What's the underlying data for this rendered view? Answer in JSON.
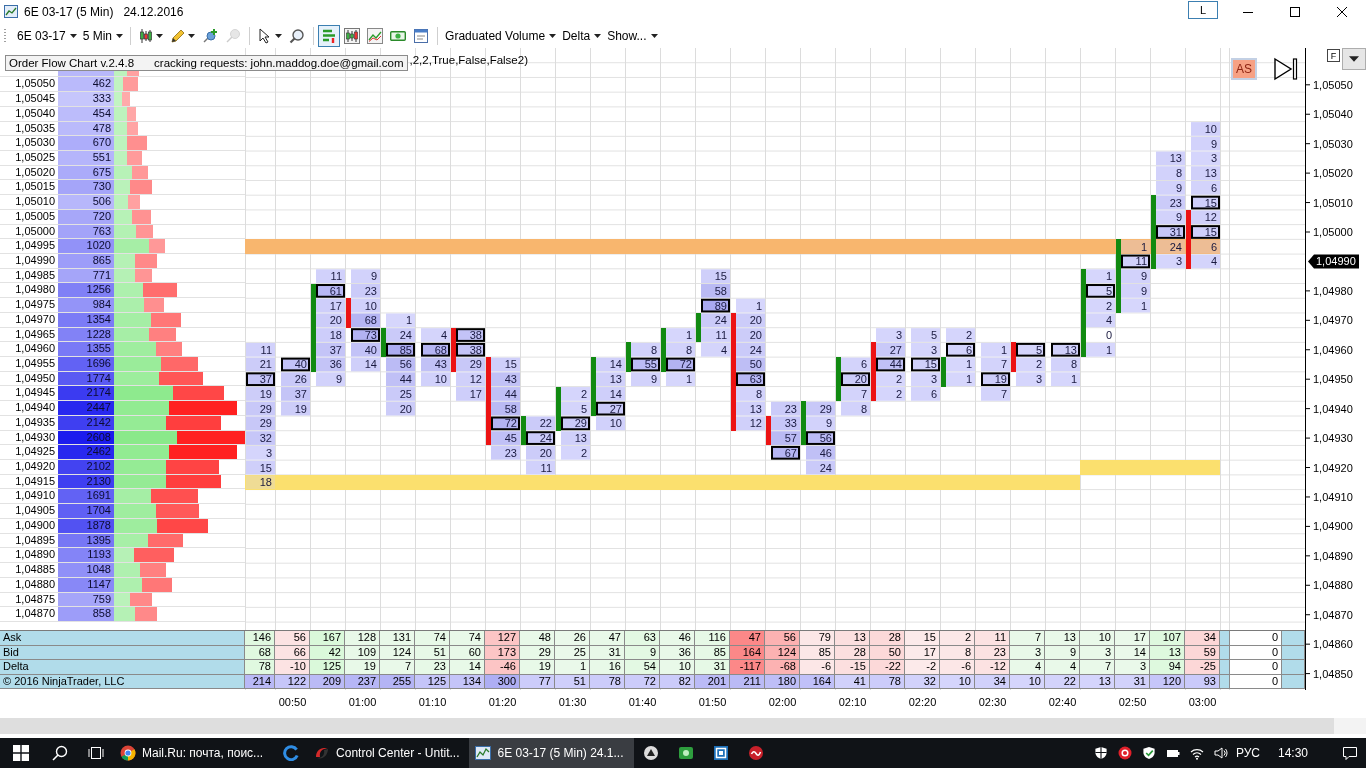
{
  "window": {
    "title": "6E 03-17 (5 Min)",
    "date": "24.12.2016",
    "layout_button": "L"
  },
  "toolbar": {
    "selectors": [
      {
        "label": "6E 03-17"
      },
      {
        "label": "5 Min"
      }
    ],
    "tool_groups": [
      [
        {
          "kind": "menu",
          "selected": false,
          "disabled": false
        },
        {
          "kind": "menu",
          "selected": false,
          "disabled": false
        },
        {
          "kind": "button",
          "selected": false,
          "disabled": false
        },
        {
          "kind": "button",
          "selected": false,
          "disabled": true
        }
      ],
      [
        {
          "kind": "menu",
          "selected": false,
          "disabled": false
        },
        {
          "kind": "button",
          "selected": false,
          "disabled": false
        }
      ],
      [
        {
          "kind": "button",
          "selected": true,
          "disabled": false
        },
        {
          "kind": "button",
          "selected": false,
          "disabled": false
        },
        {
          "kind": "button",
          "selected": false,
          "disabled": false
        },
        {
          "kind": "button",
          "selected": false,
          "disabled": false
        },
        {
          "kind": "button",
          "selected": false,
          "disabled": false
        }
      ]
    ],
    "menus": [
      {
        "label": "Graduated Volume"
      },
      {
        "label": "Delta"
      },
      {
        "label": "Show..."
      }
    ]
  },
  "info_label": {
    "title": "Order Flow Chart v.2.4.8",
    "note": "cracking requests: john.maddog.doe@gmail.com"
  },
  "indicator_params": ",2,2,True,False,False2)",
  "ladder": [
    {
      "buy": {
        "level": 0.1
      },
      "total": {
        "level": 0.19
      }
    },
    {
      "price": "1,05050",
      "volume": "462",
      "buy": {
        "level": 0.07
      },
      "total": {
        "level": 0.18
      }
    },
    {
      "price": "1,05045",
      "volume": "333",
      "buy": {
        "level": 0.06
      },
      "total": {
        "level": 0.12
      }
    },
    {
      "price": "1,05040",
      "volume": "454",
      "buy": {
        "level": 0.1
      },
      "total": {
        "level": 0.17
      }
    },
    {
      "price": "1,05035",
      "volume": "478",
      "buy": {
        "level": 0.1
      },
      "total": {
        "level": 0.18
      },
      "cells": [
        null,
        null,
        null,
        null,
        null,
        null,
        null,
        null,
        null,
        null,
        null,
        null,
        null,
        null,
        null,
        null,
        null,
        null,
        null,
        null,
        null,
        null,
        null,
        null,
        null,
        null,
        null,
        {
          "value": "10",
          "boxed": false
        }
      ]
    },
    {
      "price": "1,05030",
      "volume": "670",
      "buy": {
        "level": 0.1
      },
      "total": {
        "level": 0.25
      },
      "cells": [
        null,
        null,
        null,
        null,
        null,
        null,
        null,
        null,
        null,
        null,
        null,
        null,
        null,
        null,
        null,
        null,
        null,
        null,
        null,
        null,
        null,
        null,
        null,
        null,
        null,
        null,
        null,
        {
          "value": "9",
          "boxed": false
        }
      ]
    },
    {
      "price": "1,05025",
      "volume": "551",
      "buy": {
        "level": 0.1
      },
      "total": {
        "level": 0.21
      },
      "cells": [
        null,
        null,
        null,
        null,
        null,
        null,
        null,
        null,
        null,
        null,
        null,
        null,
        null,
        null,
        null,
        null,
        null,
        null,
        null,
        null,
        null,
        null,
        null,
        null,
        null,
        null,
        {
          "value": "13",
          "boxed": false
        },
        {
          "value": "3",
          "boxed": false
        }
      ]
    },
    {
      "price": "1,05020",
      "volume": "675",
      "buy": {
        "level": 0.14
      },
      "total": {
        "level": 0.26
      },
      "cells": [
        null,
        null,
        null,
        null,
        null,
        null,
        null,
        null,
        null,
        null,
        null,
        null,
        null,
        null,
        null,
        null,
        null,
        null,
        null,
        null,
        null,
        null,
        null,
        null,
        null,
        null,
        {
          "value": "8",
          "boxed": false
        },
        {
          "value": "13",
          "boxed": false
        }
      ]
    },
    {
      "price": "1,05015",
      "volume": "730",
      "buy": {
        "level": 0.12
      },
      "total": {
        "level": 0.29
      },
      "cells": [
        null,
        null,
        null,
        null,
        null,
        null,
        null,
        null,
        null,
        null,
        null,
        null,
        null,
        null,
        null,
        null,
        null,
        null,
        null,
        null,
        null,
        null,
        null,
        null,
        null,
        null,
        {
          "value": "9",
          "boxed": false
        },
        {
          "value": "6",
          "boxed": false
        }
      ]
    },
    {
      "price": "1,05010",
      "volume": "506",
      "buy": {
        "level": 0.11
      },
      "total": {
        "level": 0.2
      },
      "cells": [
        null,
        null,
        null,
        null,
        null,
        null,
        null,
        null,
        null,
        null,
        null,
        null,
        null,
        null,
        null,
        null,
        null,
        null,
        null,
        null,
        null,
        null,
        null,
        null,
        null,
        null,
        {
          "value": "23",
          "boxed": false,
          "bar": {
            "color": "#118a11"
          }
        },
        {
          "value": "15",
          "boxed": true
        }
      ]
    },
    {
      "price": "1,05005",
      "volume": "720",
      "buy": {
        "level": 0.14
      },
      "total": {
        "level": 0.28
      },
      "cells": [
        null,
        null,
        null,
        null,
        null,
        null,
        null,
        null,
        null,
        null,
        null,
        null,
        null,
        null,
        null,
        null,
        null,
        null,
        null,
        null,
        null,
        null,
        null,
        null,
        null,
        null,
        {
          "value": "9",
          "boxed": false,
          "bar": {
            "color": "#118a11"
          }
        },
        {
          "value": "12",
          "boxed": false,
          "bar": {
            "color": "#ec1313"
          }
        }
      ]
    },
    {
      "price": "1,05000",
      "volume": "763",
      "buy": {
        "level": 0.17
      },
      "total": {
        "level": 0.3
      },
      "cells": [
        null,
        null,
        null,
        null,
        null,
        null,
        null,
        null,
        null,
        null,
        null,
        null,
        null,
        null,
        null,
        null,
        null,
        null,
        null,
        null,
        null,
        null,
        null,
        null,
        null,
        null,
        {
          "value": "31",
          "boxed": true,
          "bar": {
            "color": "#118a11"
          }
        },
        {
          "value": "15",
          "boxed": true,
          "bar": {
            "color": "#ec1313"
          }
        }
      ]
    },
    {
      "price": "1,04995",
      "volume": "1020",
      "buy": {
        "level": 0.27
      },
      "total": {
        "level": 0.39
      },
      "cells": [
        {
          "band": {
            "color": "#f8b66e"
          }
        },
        {
          "band": {
            "color": "#f8b66e"
          }
        },
        {
          "band": {
            "color": "#f8b66e"
          }
        },
        {
          "band": {
            "color": "#f8b66e"
          }
        },
        {
          "band": {
            "color": "#f8b66e"
          }
        },
        {
          "band": {
            "color": "#f8b66e"
          }
        },
        {
          "band": {
            "color": "#f8b66e"
          }
        },
        {
          "band": {
            "color": "#f8b66e"
          }
        },
        {
          "band": {
            "color": "#f8b66e"
          }
        },
        {
          "band": {
            "color": "#f8b66e"
          }
        },
        {
          "band": {
            "color": "#f8b66e"
          }
        },
        {
          "band": {
            "color": "#f8b66e"
          }
        },
        {
          "band": {
            "color": "#f8b66e"
          }
        },
        {
          "band": {
            "color": "#f8b66e"
          }
        },
        {
          "band": {
            "color": "#f8b66e"
          }
        },
        {
          "band": {
            "color": "#f8b66e"
          }
        },
        {
          "band": {
            "color": "#f8b66e"
          }
        },
        {
          "band": {
            "color": "#f8b66e"
          }
        },
        {
          "band": {
            "color": "#f8b66e"
          }
        },
        {
          "band": {
            "color": "#f8b66e"
          }
        },
        {
          "band": {
            "color": "#f8b66e"
          }
        },
        {
          "band": {
            "color": "#f8b66e"
          }
        },
        {
          "band": {
            "color": "#f8b66e"
          }
        },
        {
          "band": {
            "color": "#f8b66e"
          }
        },
        {
          "band": {
            "color": "#f8b66e"
          }
        },
        {
          "value": "1",
          "boxed": false,
          "bar": {
            "color": "#118a11"
          },
          "band": {
            "color": "#f8b66e"
          }
        },
        {
          "value": "24",
          "boxed": false,
          "bar": {
            "color": "#118a11"
          },
          "band": {
            "color": "#f8b66e"
          }
        },
        {
          "value": "6",
          "boxed": false,
          "bar": {
            "color": "#ec1313"
          },
          "band": {
            "color": "#f8b66e"
          }
        }
      ]
    },
    {
      "price": "1,04990",
      "volume": "865",
      "buy": {
        "level": 0.16
      },
      "total": {
        "level": 0.33
      },
      "cells": [
        null,
        null,
        null,
        null,
        null,
        null,
        null,
        null,
        null,
        null,
        null,
        null,
        null,
        null,
        null,
        null,
        null,
        null,
        null,
        null,
        null,
        null,
        null,
        null,
        null,
        {
          "value": "11",
          "boxed": true,
          "bar": {
            "color": "#118a11"
          }
        },
        {
          "value": "3",
          "boxed": false,
          "bar": {
            "color": "#118a11"
          }
        },
        {
          "value": "4",
          "boxed": false,
          "bar": {
            "color": "#ec1313"
          }
        }
      ]
    },
    {
      "price": "1,04985",
      "volume": "771",
      "buy": {
        "level": 0.16
      },
      "total": {
        "level": 0.29
      },
      "cells": [
        null,
        null,
        {
          "value": "11",
          "boxed": false
        },
        {
          "value": "9",
          "boxed": false
        },
        null,
        null,
        null,
        null,
        null,
        null,
        null,
        null,
        null,
        {
          "value": "15",
          "boxed": false
        },
        null,
        null,
        null,
        null,
        null,
        null,
        null,
        null,
        null,
        null,
        {
          "value": "1",
          "boxed": false,
          "bar": {
            "color": "#118a11"
          }
        },
        {
          "value": "9",
          "boxed": false,
          "bar": {
            "color": "#118a11"
          }
        }
      ]
    },
    {
      "price": "1,04980",
      "volume": "1256",
      "buy": {
        "level": 0.22
      },
      "total": {
        "level": 0.48
      },
      "cells": [
        null,
        null,
        {
          "value": "61",
          "boxed": true,
          "bar": {
            "color": "#118a11"
          }
        },
        {
          "value": "23",
          "boxed": false
        },
        null,
        null,
        null,
        null,
        null,
        null,
        null,
        null,
        null,
        {
          "value": "58",
          "boxed": false
        },
        null,
        null,
        null,
        null,
        null,
        null,
        null,
        null,
        null,
        null,
        {
          "value": "5",
          "boxed": true,
          "bar": {
            "color": "#118a11"
          }
        },
        {
          "value": "9",
          "boxed": false,
          "bar": {
            "color": "#118a11"
          }
        }
      ]
    },
    {
      "price": "1,04975",
      "volume": "984",
      "buy": {
        "level": 0.23
      },
      "total": {
        "level": 0.38
      },
      "cells": [
        null,
        null,
        {
          "value": "17",
          "boxed": false,
          "bar": {
            "color": "#118a11"
          }
        },
        {
          "value": "10",
          "boxed": false,
          "bar": {
            "color": "#ec1313"
          }
        },
        null,
        null,
        null,
        null,
        null,
        null,
        null,
        null,
        null,
        {
          "value": "89",
          "boxed": true
        },
        {
          "value": "1",
          "boxed": false
        },
        null,
        null,
        null,
        null,
        null,
        null,
        null,
        null,
        null,
        {
          "value": "2",
          "boxed": false,
          "bar": {
            "color": "#118a11"
          }
        },
        {
          "value": "1",
          "boxed": false,
          "bar": {
            "color": "#118a11"
          }
        }
      ]
    },
    {
      "price": "1,04970",
      "volume": "1354",
      "buy": {
        "level": 0.28
      },
      "total": {
        "level": 0.51
      },
      "cells": [
        null,
        null,
        {
          "value": "20",
          "boxed": false,
          "bar": {
            "color": "#118a11"
          }
        },
        {
          "value": "68",
          "boxed": false,
          "bar": {
            "color": "#ec1313"
          }
        },
        {
          "value": "1",
          "boxed": false
        },
        null,
        null,
        null,
        null,
        null,
        null,
        null,
        null,
        {
          "value": "24",
          "boxed": false,
          "bar": {
            "color": "#118a11"
          }
        },
        {
          "value": "20",
          "boxed": false,
          "bar": {
            "color": "#ec1313"
          }
        },
        null,
        null,
        null,
        null,
        null,
        null,
        null,
        null,
        null,
        {
          "value": "4",
          "boxed": false,
          "bar": {
            "color": "#118a11"
          }
        }
      ]
    },
    {
      "price": "1,04965",
      "volume": "1228",
      "buy": {
        "level": 0.27
      },
      "total": {
        "level": 0.47
      },
      "cells": [
        null,
        null,
        {
          "value": "18",
          "boxed": false,
          "bar": {
            "color": "#118a11"
          }
        },
        {
          "value": "73",
          "boxed": true
        },
        {
          "value": "24",
          "boxed": false,
          "bar": {
            "color": "#118a11"
          }
        },
        {
          "value": "4",
          "boxed": false
        },
        {
          "value": "38",
          "boxed": true,
          "bar": {
            "color": "#ec1313"
          }
        },
        null,
        null,
        null,
        null,
        null,
        {
          "value": "1",
          "boxed": false,
          "bar": {
            "color": "#118a11"
          }
        },
        {
          "value": "11",
          "boxed": false,
          "bar": {
            "color": "#118a11"
          }
        },
        {
          "value": "20",
          "boxed": false,
          "bar": {
            "color": "#ec1313"
          }
        },
        null,
        null,
        null,
        {
          "value": "3",
          "boxed": false
        },
        {
          "value": "5",
          "boxed": false
        },
        {
          "value": "2",
          "boxed": false
        },
        null,
        null,
        null,
        {
          "value": "0",
          "boxed": false,
          "bar": {
            "color": "#118a11"
          }
        }
      ]
    },
    {
      "price": "1,04960",
      "volume": "1355",
      "buy": {
        "level": 0.32
      },
      "total": {
        "level": 0.52
      },
      "cells": [
        {
          "value": "11",
          "boxed": false
        },
        null,
        {
          "value": "37",
          "boxed": false,
          "bar": {
            "color": "#118a11"
          }
        },
        {
          "value": "40",
          "boxed": false
        },
        {
          "value": "85",
          "boxed": true,
          "bar": {
            "color": "#118a11"
          }
        },
        {
          "value": "68",
          "boxed": true
        },
        {
          "value": "38",
          "boxed": true,
          "bar": {
            "color": "#ec1313"
          }
        },
        null,
        null,
        null,
        null,
        {
          "value": "8",
          "boxed": false,
          "bar": {
            "color": "#118a11"
          }
        },
        {
          "value": "8",
          "boxed": false,
          "bar": {
            "color": "#118a11"
          }
        },
        {
          "value": "4",
          "boxed": false
        },
        {
          "value": "24",
          "boxed": false,
          "bar": {
            "color": "#ec1313"
          }
        },
        null,
        null,
        null,
        {
          "value": "27",
          "boxed": false,
          "bar": {
            "color": "#ec1313"
          }
        },
        {
          "value": "3",
          "boxed": false
        },
        {
          "value": "6",
          "boxed": true
        },
        {
          "value": "1",
          "boxed": false
        },
        {
          "value": "5",
          "boxed": true,
          "bar": {
            "color": "#ec1313"
          }
        },
        {
          "value": "13",
          "boxed": true
        },
        {
          "value": "1",
          "boxed": false,
          "bar": {
            "color": "#118a11"
          }
        }
      ]
    },
    {
      "price": "1,04955",
      "volume": "1696",
      "buy": {
        "level": 0.36
      },
      "total": {
        "level": 0.64
      },
      "cells": [
        {
          "value": "21",
          "boxed": false
        },
        {
          "value": "40",
          "boxed": true
        },
        {
          "value": "36",
          "boxed": false,
          "bar": {
            "color": "#118a11"
          }
        },
        {
          "value": "14",
          "boxed": false
        },
        {
          "value": "56",
          "boxed": false
        },
        {
          "value": "43",
          "boxed": false
        },
        {
          "value": "29",
          "boxed": false,
          "bar": {
            "color": "#ec1313"
          }
        },
        {
          "value": "15",
          "boxed": false,
          "bar": {
            "color": "#ec1313"
          }
        },
        null,
        null,
        {
          "value": "14",
          "boxed": false,
          "bar": {
            "color": "#118a11"
          }
        },
        {
          "value": "55",
          "boxed": true,
          "bar": {
            "color": "#118a11"
          }
        },
        {
          "value": "72",
          "boxed": true,
          "bar": {
            "color": "#118a11"
          }
        },
        null,
        {
          "value": "50",
          "boxed": false,
          "bar": {
            "color": "#ec1313"
          }
        },
        null,
        null,
        {
          "value": "6",
          "boxed": false,
          "bar": {
            "color": "#118a11"
          }
        },
        {
          "value": "44",
          "boxed": true,
          "bar": {
            "color": "#ec1313"
          }
        },
        {
          "value": "15",
          "boxed": true
        },
        {
          "value": "1",
          "boxed": false,
          "bar": {
            "color": "#118a11"
          }
        },
        {
          "value": "7",
          "boxed": false
        },
        {
          "value": "2",
          "boxed": false,
          "bar": {
            "color": "#ec1313"
          }
        },
        {
          "value": "8",
          "boxed": false
        }
      ]
    },
    {
      "price": "1,04950",
      "volume": "1774",
      "buy": {
        "level": 0.34
      },
      "total": {
        "level": 0.68
      },
      "cells": [
        {
          "value": "37",
          "boxed": true
        },
        {
          "value": "26",
          "boxed": false
        },
        {
          "value": "9",
          "boxed": false
        },
        null,
        {
          "value": "44",
          "boxed": false
        },
        {
          "value": "10",
          "boxed": false
        },
        {
          "value": "12",
          "boxed": false
        },
        {
          "value": "43",
          "boxed": false,
          "bar": {
            "color": "#ec1313"
          }
        },
        null,
        null,
        {
          "value": "13",
          "boxed": false,
          "bar": {
            "color": "#118a11"
          }
        },
        {
          "value": "9",
          "boxed": false
        },
        {
          "value": "1",
          "boxed": false
        },
        null,
        {
          "value": "63",
          "boxed": true,
          "bar": {
            "color": "#ec1313"
          }
        },
        null,
        null,
        {
          "value": "20",
          "boxed": true,
          "bar": {
            "color": "#118a11"
          }
        },
        {
          "value": "2",
          "boxed": false,
          "bar": {
            "color": "#ec1313"
          }
        },
        {
          "value": "3",
          "boxed": false
        },
        {
          "value": "1",
          "boxed": false,
          "bar": {
            "color": "#118a11"
          }
        },
        {
          "value": "19",
          "boxed": true
        },
        {
          "value": "3",
          "boxed": false
        },
        {
          "value": "1",
          "boxed": false
        }
      ]
    },
    {
      "price": "1,04945",
      "volume": "2174",
      "buy": {
        "level": 0.45
      },
      "total": {
        "level": 0.84
      },
      "cells": [
        {
          "value": "19",
          "boxed": false
        },
        {
          "value": "37",
          "boxed": false
        },
        null,
        null,
        {
          "value": "25",
          "boxed": false
        },
        null,
        {
          "value": "17",
          "boxed": false
        },
        {
          "value": "44",
          "boxed": false,
          "bar": {
            "color": "#ec1313"
          }
        },
        null,
        {
          "value": "2",
          "boxed": false,
          "bar": {
            "color": "#118a11"
          }
        },
        {
          "value": "14",
          "boxed": false,
          "bar": {
            "color": "#118a11"
          }
        },
        null,
        null,
        null,
        {
          "value": "8",
          "boxed": false,
          "bar": {
            "color": "#ec1313"
          }
        },
        null,
        null,
        {
          "value": "7",
          "boxed": false,
          "bar": {
            "color": "#118a11"
          }
        },
        {
          "value": "2",
          "boxed": false,
          "bar": {
            "color": "#ec1313"
          }
        },
        {
          "value": "6",
          "boxed": false
        },
        null,
        {
          "value": "7",
          "boxed": false
        }
      ]
    },
    {
      "price": "1,04940",
      "volume": "2447",
      "buy": {
        "level": 0.42
      },
      "total": {
        "level": 0.94
      },
      "cells": [
        {
          "value": "29",
          "boxed": false
        },
        {
          "value": "19",
          "boxed": false
        },
        null,
        null,
        {
          "value": "20",
          "boxed": false
        },
        null,
        null,
        {
          "value": "58",
          "boxed": false,
          "bar": {
            "color": "#ec1313"
          }
        },
        null,
        {
          "value": "5",
          "boxed": false,
          "bar": {
            "color": "#118a11"
          }
        },
        {
          "value": "27",
          "boxed": true,
          "bar": {
            "color": "#118a11"
          }
        },
        null,
        null,
        null,
        {
          "value": "13",
          "boxed": false,
          "bar": {
            "color": "#ec1313"
          }
        },
        {
          "value": "23",
          "boxed": false
        },
        {
          "value": "29",
          "boxed": false,
          "bar": {
            "color": "#118a11"
          }
        },
        {
          "value": "8",
          "boxed": false
        }
      ]
    },
    {
      "price": "1,04935",
      "volume": "2142",
      "buy": {
        "level": 0.4
      },
      "total": {
        "level": 0.82
      },
      "cells": [
        {
          "value": "29",
          "boxed": false
        },
        null,
        null,
        null,
        null,
        null,
        null,
        {
          "value": "72",
          "boxed": true,
          "bar": {
            "color": "#ec1313"
          }
        },
        {
          "value": "22",
          "boxed": false,
          "bar": {
            "color": "#118a11"
          }
        },
        {
          "value": "29",
          "boxed": true,
          "bar": {
            "color": "#118a11"
          }
        },
        {
          "value": "10",
          "boxed": false
        },
        null,
        null,
        null,
        {
          "value": "12",
          "boxed": false,
          "bar": {
            "color": "#ec1313"
          }
        },
        {
          "value": "33",
          "boxed": false,
          "bar": {
            "color": "#ec1313"
          }
        },
        {
          "value": "9",
          "boxed": false,
          "bar": {
            "color": "#118a11"
          }
        }
      ]
    },
    {
      "price": "1,04930",
      "volume": "2608",
      "buy": {
        "level": 0.48
      },
      "total": {
        "level": 1.0
      },
      "cells": [
        {
          "value": "32",
          "boxed": false
        },
        null,
        null,
        null,
        null,
        null,
        null,
        {
          "value": "45",
          "boxed": false,
          "bar": {
            "color": "#ec1313"
          }
        },
        {
          "value": "24",
          "boxed": true,
          "bar": {
            "color": "#118a11"
          }
        },
        {
          "value": "13",
          "boxed": false
        },
        null,
        null,
        null,
        null,
        null,
        {
          "value": "57",
          "boxed": false,
          "bar": {
            "color": "#ec1313"
          }
        },
        {
          "value": "56",
          "boxed": true,
          "bar": {
            "color": "#118a11"
          }
        }
      ]
    },
    {
      "price": "1,04925",
      "volume": "2462",
      "buy": {
        "level": 0.42
      },
      "total": {
        "level": 0.94
      },
      "cells": [
        {
          "value": "3",
          "boxed": false
        },
        null,
        null,
        null,
        null,
        null,
        null,
        {
          "value": "23",
          "boxed": false
        },
        {
          "value": "20",
          "boxed": false
        },
        {
          "value": "2",
          "boxed": false
        },
        null,
        null,
        null,
        null,
        null,
        {
          "value": "67",
          "boxed": true
        },
        {
          "value": "46",
          "boxed": false
        }
      ]
    },
    {
      "price": "1,04920",
      "volume": "2102",
      "buy": {
        "level": 0.4
      },
      "total": {
        "level": 0.8
      },
      "cells": [
        {
          "value": "15",
          "boxed": false
        },
        null,
        null,
        null,
        null,
        null,
        null,
        null,
        {
          "value": "11",
          "boxed": false
        },
        null,
        null,
        null,
        null,
        null,
        null,
        null,
        {
          "value": "24",
          "boxed": false
        },
        null,
        null,
        null,
        null,
        null,
        null,
        null,
        {
          "band": {
            "color": "#fbe06e"
          }
        },
        {
          "band": {
            "color": "#fbe06e"
          }
        },
        {
          "band": {
            "color": "#fbe06e"
          }
        },
        {
          "band": {
            "color": "#fbe06e"
          }
        }
      ]
    },
    {
      "price": "1,04915",
      "volume": "2130",
      "buy": {
        "level": 0.4
      },
      "total": {
        "level": 0.82
      },
      "cells": [
        {
          "value": "18",
          "boxed": false,
          "band": {
            "color": "#fbe06e"
          }
        },
        {
          "band": {
            "color": "#fbe06e"
          }
        },
        {
          "band": {
            "color": "#fbe06e"
          }
        },
        {
          "band": {
            "color": "#fbe06e"
          }
        },
        {
          "band": {
            "color": "#fbe06e"
          }
        },
        {
          "band": {
            "color": "#fbe06e"
          }
        },
        {
          "band": {
            "color": "#fbe06e"
          }
        },
        {
          "band": {
            "color": "#fbe06e"
          }
        },
        {
          "band": {
            "color": "#fbe06e"
          }
        },
        {
          "band": {
            "color": "#fbe06e"
          }
        },
        {
          "band": {
            "color": "#fbe06e"
          }
        },
        {
          "band": {
            "color": "#fbe06e"
          }
        },
        {
          "band": {
            "color": "#fbe06e"
          }
        },
        {
          "band": {
            "color": "#fbe06e"
          }
        },
        {
          "band": {
            "color": "#fbe06e"
          }
        },
        {
          "band": {
            "color": "#fbe06e"
          }
        },
        {
          "band": {
            "color": "#fbe06e"
          }
        },
        {
          "band": {
            "color": "#fbe06e"
          }
        },
        {
          "band": {
            "color": "#fbe06e"
          }
        },
        {
          "band": {
            "color": "#fbe06e"
          }
        },
        {
          "band": {
            "color": "#fbe06e"
          }
        },
        {
          "band": {
            "color": "#fbe06e"
          }
        },
        {
          "band": {
            "color": "#fbe06e"
          }
        },
        {
          "band": {
            "color": "#fbe06e"
          }
        }
      ]
    },
    {
      "price": "1,04910",
      "volume": "1691",
      "buy": {
        "level": 0.28
      },
      "total": {
        "level": 0.64
      }
    },
    {
      "price": "1,04905",
      "volume": "1704",
      "buy": {
        "level": 0.32
      },
      "total": {
        "level": 0.65
      }
    },
    {
      "price": "1,04900",
      "volume": "1878",
      "buy": {
        "level": 0.33
      },
      "total": {
        "level": 0.72
      }
    },
    {
      "price": "1,04895",
      "volume": "1395",
      "buy": {
        "level": 0.26
      },
      "total": {
        "level": 0.53
      }
    },
    {
      "price": "1,04890",
      "volume": "1193",
      "buy": {
        "level": 0.15
      },
      "total": {
        "level": 0.46
      }
    },
    {
      "price": "1,04885",
      "volume": "1048",
      "buy": {
        "level": 0.2
      },
      "total": {
        "level": 0.4
      }
    },
    {
      "price": "1,04880",
      "volume": "1147",
      "buy": {
        "level": 0.21
      },
      "total": {
        "level": 0.44
      }
    },
    {
      "price": "1,04875",
      "volume": "759",
      "buy": {
        "level": 0.12
      },
      "total": {
        "level": 0.29
      }
    },
    {
      "price": "1,04870",
      "volume": "858",
      "buy": {
        "level": 0.16
      },
      "total": {
        "level": 0.33
      }
    }
  ],
  "chart": {
    "auto_scale": {
      "label": "AS",
      "on": true
    },
    "panel_toggle": "F",
    "price_axis": [
      {
        "kind": "tick",
        "label": "1,05050"
      },
      {
        "kind": "tick",
        "label": "1,05040"
      },
      {
        "kind": "tick",
        "label": "1,05030"
      },
      {
        "kind": "tick",
        "label": "1,05020"
      },
      {
        "kind": "tick",
        "label": "1,05010"
      },
      {
        "kind": "tick",
        "label": "1,05000"
      },
      {
        "kind": "marker",
        "label": "1,04990"
      },
      {
        "kind": "tick",
        "label": "1,04980"
      },
      {
        "kind": "tick",
        "label": "1,04970"
      },
      {
        "kind": "tick",
        "label": "1,04960"
      },
      {
        "kind": "tick",
        "label": "1,04950"
      },
      {
        "kind": "tick",
        "label": "1,04940"
      },
      {
        "kind": "tick",
        "label": "1,04930"
      },
      {
        "kind": "tick",
        "label": "1,04920"
      },
      {
        "kind": "tick",
        "label": "1,04910"
      },
      {
        "kind": "tick",
        "label": "1,04900"
      },
      {
        "kind": "tick",
        "label": "1,04890"
      },
      {
        "kind": "tick",
        "label": "1,04880"
      },
      {
        "kind": "tick",
        "label": "1,04870"
      },
      {
        "kind": "tick",
        "label": "1,04860"
      },
      {
        "kind": "tick",
        "label": "1,04850"
      }
    ],
    "time_labels": [
      "00:50",
      "01:00",
      "01:10",
      "01:20",
      "01:30",
      "01:40",
      "01:50",
      "02:00",
      "02:10",
      "02:20",
      "02:30",
      "02:40",
      "02:50",
      "03:00"
    ]
  },
  "summary": {
    "rows": [
      {
        "kind": "ask",
        "label": "Ask",
        "values": [
          "146",
          "56",
          "167",
          "128",
          "131",
          "74",
          "74",
          "127",
          "48",
          "26",
          "47",
          "63",
          "46",
          "116",
          "47",
          "56",
          "79",
          "13",
          "28",
          "15",
          "2",
          "11",
          "7",
          "13",
          "10",
          "17",
          "107",
          "34"
        ],
        "total": "0"
      },
      {
        "kind": "bid",
        "label": "Bid",
        "values": [
          "68",
          "66",
          "42",
          "109",
          "124",
          "51",
          "60",
          "173",
          "29",
          "25",
          "31",
          "9",
          "36",
          "85",
          "164",
          "124",
          "85",
          "28",
          "50",
          "17",
          "8",
          "23",
          "3",
          "9",
          "3",
          "14",
          "13",
          "59"
        ],
        "total": "0"
      },
      {
        "kind": "delta",
        "label": "Delta",
        "values": [
          "78",
          "-10",
          "125",
          "19",
          "7",
          "23",
          "14",
          "-46",
          "19",
          "1",
          "16",
          "54",
          "10",
          "31",
          "-117",
          "-68",
          "-6",
          "-15",
          "-22",
          "-2",
          "-6",
          "-12",
          "4",
          "4",
          "7",
          "3",
          "94",
          "-25"
        ],
        "total": "0"
      },
      {
        "kind": "volume",
        "values": [
          "214",
          "122",
          "209",
          "237",
          "255",
          "125",
          "134",
          "300",
          "77",
          "51",
          "78",
          "72",
          "82",
          "201",
          "211",
          "180",
          "164",
          "41",
          "78",
          "32",
          "10",
          "34",
          "10",
          "22",
          "13",
          "31",
          "120",
          "93"
        ],
        "total": "0"
      }
    ],
    "copyright": "© 2016 NinjaTrader, LLC"
  },
  "taskbar": {
    "items": [
      {
        "kind": "window",
        "label": "Mail.Ru: почта, поис...",
        "selected": false
      },
      {
        "kind": "pinned",
        "selected": false
      },
      {
        "kind": "window",
        "label": "Control Center - Untit...",
        "selected": false
      },
      {
        "kind": "window",
        "label": "6E 03-17 (5 Min) 24.1...",
        "selected": true
      },
      {
        "kind": "pinned",
        "selected": false
      },
      {
        "kind": "pinned",
        "selected": false
      },
      {
        "kind": "pinned",
        "selected": false
      },
      {
        "kind": "pinned",
        "selected": false
      }
    ],
    "language": "РУС",
    "time": "14:30"
  }
}
